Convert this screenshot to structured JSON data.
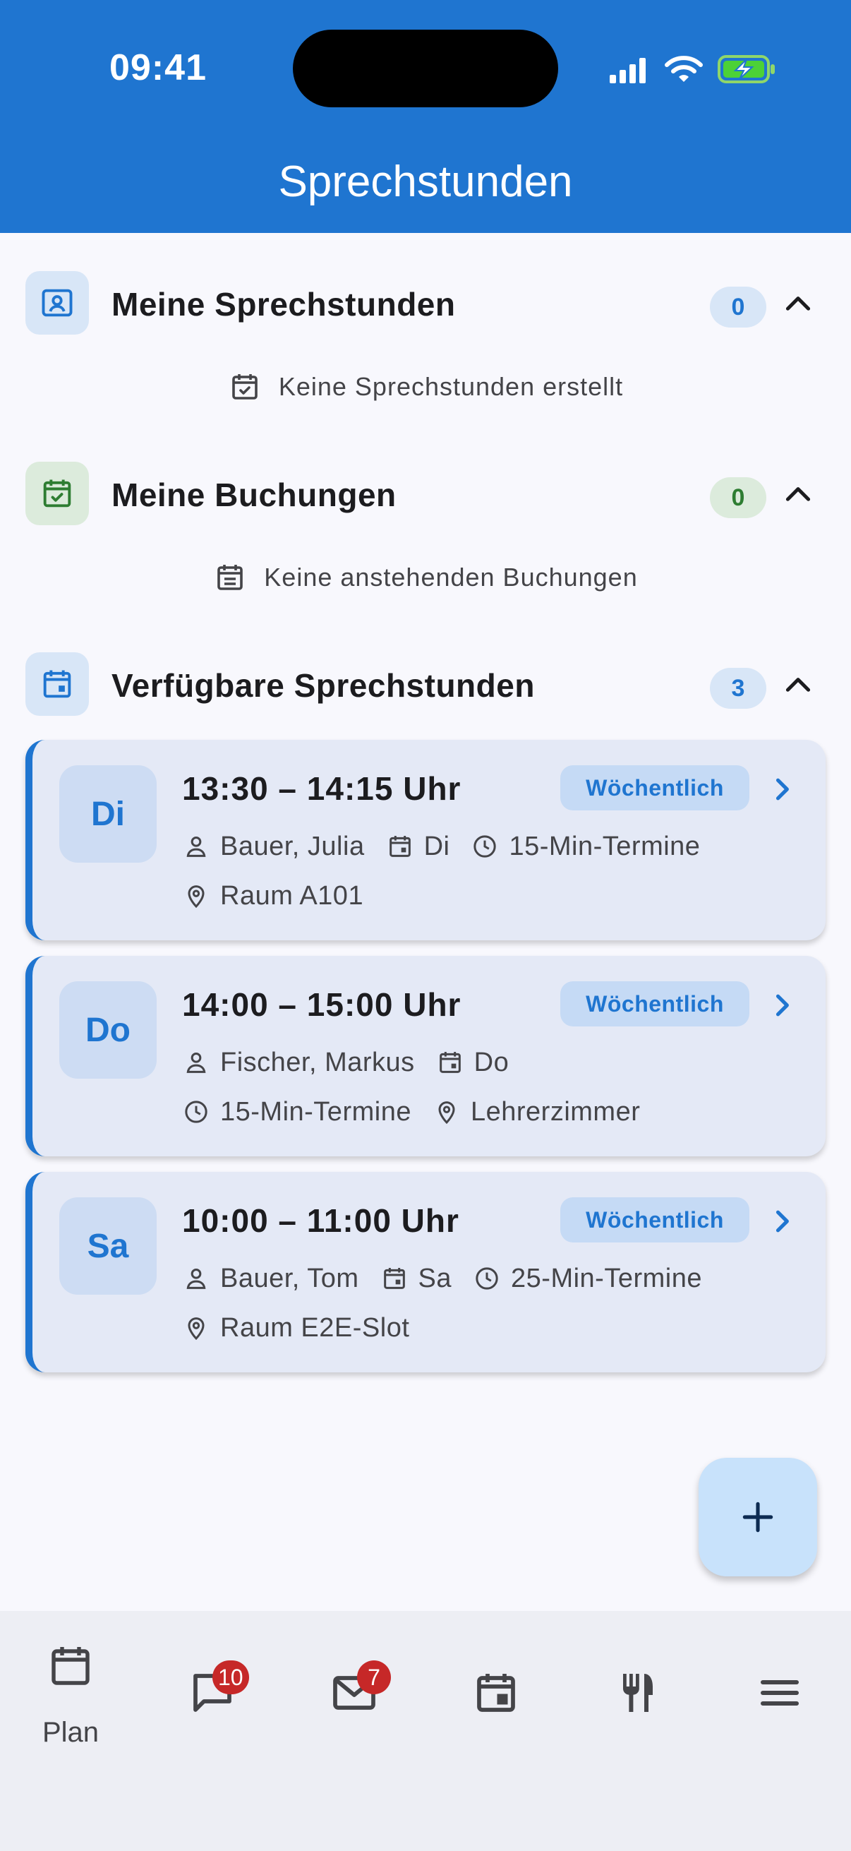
{
  "status_bar": {
    "time": "09:41"
  },
  "header": {
    "title": "Sprechstunden"
  },
  "sections": {
    "mine": {
      "title": "Meine Sprechstunden",
      "count": "0",
      "empty_text": "Keine Sprechstunden erstellt",
      "icon": "contact-card-icon",
      "accent": "#1f75d0"
    },
    "bookings": {
      "title": "Meine Buchungen",
      "count": "0",
      "empty_text": "Keine anstehenden Buchungen",
      "icon": "calendar-check-icon",
      "accent": "#2e7d32"
    },
    "available": {
      "title": "Verfügbare Sprechstunden",
      "count": "3",
      "icon": "calendar-icon",
      "accent": "#1f75d0"
    }
  },
  "slots": [
    {
      "day": "Di",
      "time": "13:30 – 14:15 Uhr",
      "recurrence": "Wöchentlich",
      "teacher": "Bauer, Julia",
      "weekday": "Di",
      "duration": "15-Min-Termine",
      "room": "Raum A101"
    },
    {
      "day": "Do",
      "time": "14:00 – 15:00 Uhr",
      "recurrence": "Wöchentlich",
      "teacher": "Fischer, Markus",
      "weekday": "Do",
      "duration": "15-Min-Termine",
      "room": "Lehrerzimmer"
    },
    {
      "day": "Sa",
      "time": "10:00 – 11:00 Uhr",
      "recurrence": "Wöchentlich",
      "teacher": "Bauer, Tom",
      "weekday": "Sa",
      "duration": "25-Min-Termine",
      "room": "Raum E2E-Slot"
    }
  ],
  "fab": {
    "icon": "plus-icon"
  },
  "bottom_nav": {
    "plan": {
      "label": "Plan",
      "icon": "calendar-icon"
    },
    "chat": {
      "icon": "chat-icon",
      "badge": "10"
    },
    "mail": {
      "icon": "mail-icon",
      "badge": "7"
    },
    "events": {
      "icon": "event-icon"
    },
    "food": {
      "icon": "cutlery-icon"
    },
    "menu": {
      "icon": "menu-icon"
    }
  },
  "colors": {
    "primary": "#1f75d0",
    "success": "#2e7d32",
    "badge": "#c62828",
    "card_bg": "#e4e9f6"
  }
}
